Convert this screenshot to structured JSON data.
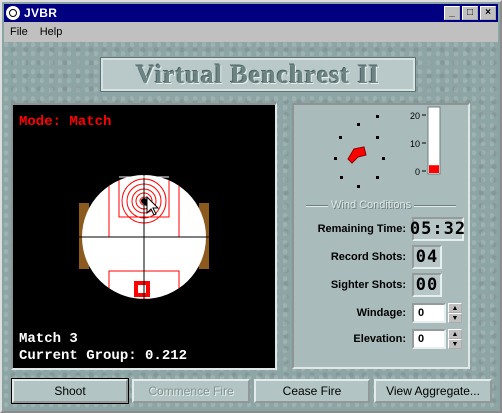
{
  "window": {
    "title": "JVBR",
    "app_icon": "target-icon",
    "controls": {
      "minimize": "_",
      "maximize": "□",
      "close": "×"
    }
  },
  "menu": {
    "items": [
      "File",
      "Help"
    ]
  },
  "logo": {
    "text": "Virtual Benchrest II"
  },
  "scope": {
    "mode_text": "Mode: Match",
    "match_text": "Match 3",
    "group_text": "Current Group: 0.212"
  },
  "wind": {
    "label": "Wind Conditions",
    "gauge_ticks": [
      "20",
      "10",
      "0"
    ],
    "speed_level": 3,
    "speed_max": 25,
    "flag_color": "#ff0000",
    "gauge_fill": "#ff0000"
  },
  "stats": {
    "remaining_time_label": "Remaining Time:",
    "remaining_time_value": "05:32",
    "record_shots_label": "Record Shots:",
    "record_shots_value": "04",
    "sighter_shots_label": "Sighter Shots:",
    "sighter_shots_value": "00",
    "windage_label": "Windage:",
    "windage_value": "0",
    "elevation_label": "Elevation:",
    "elevation_value": "0"
  },
  "buttons": {
    "shoot": "Shoot",
    "commence_fire": "Commence Fire",
    "cease_fire": "Cease Fire",
    "view_aggregate": "View Aggregate..."
  },
  "colors": {
    "titlebar": "#000080",
    "scope_bg": "#000000",
    "target_red": "#ff0000",
    "mode_text": "#ff0000",
    "background": "#8ea5a5"
  }
}
